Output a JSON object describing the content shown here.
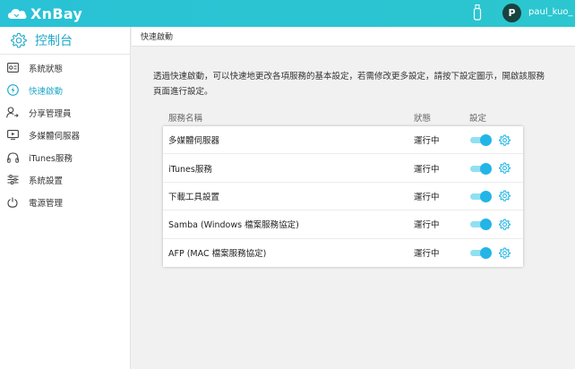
{
  "app": {
    "brand": "XnBay",
    "brand_color": "#29c2d6",
    "user_initial": "P",
    "username": "paul_kuo_"
  },
  "sidebar": {
    "header_label": "控制台",
    "items": [
      {
        "label": "系統狀態",
        "icon": "system-status-icon",
        "active": false
      },
      {
        "label": "快速啟動",
        "icon": "quick-start-icon",
        "active": true
      },
      {
        "label": "分享管理員",
        "icon": "user-share-icon",
        "active": false
      },
      {
        "label": "多媒體伺服器",
        "icon": "media-server-icon",
        "active": false
      },
      {
        "label": "iTunes服務",
        "icon": "headphones-icon",
        "active": false
      },
      {
        "label": "系統設置",
        "icon": "sliders-icon",
        "active": false
      },
      {
        "label": "電源管理",
        "icon": "power-icon",
        "active": false
      }
    ]
  },
  "main": {
    "breadcrumb": "快速啟動",
    "description": "透過快速啟動，可以快速地更改各項服務的基本設定，若需修改更多設定，請按下設定圖示，開啟該服務頁面進行設定。",
    "columns": {
      "name": "服務名稱",
      "status": "狀態",
      "settings": "設定"
    },
    "services": [
      {
        "name": "多媒體伺服器",
        "status": "運行中",
        "enabled": true
      },
      {
        "name": "iTunes服務",
        "status": "運行中",
        "enabled": true
      },
      {
        "name": "下載工具設置",
        "status": "運行中",
        "enabled": true
      },
      {
        "name": "Samba (Windows 檔案服務協定)",
        "status": "運行中",
        "enabled": true
      },
      {
        "name": "AFP (MAC 檔案服務協定)",
        "status": "運行中",
        "enabled": true
      }
    ]
  },
  "colors": {
    "accent": "#1fa8c9",
    "toggle_on": "#23b5e6",
    "toggle_track": "#90e0f2"
  }
}
